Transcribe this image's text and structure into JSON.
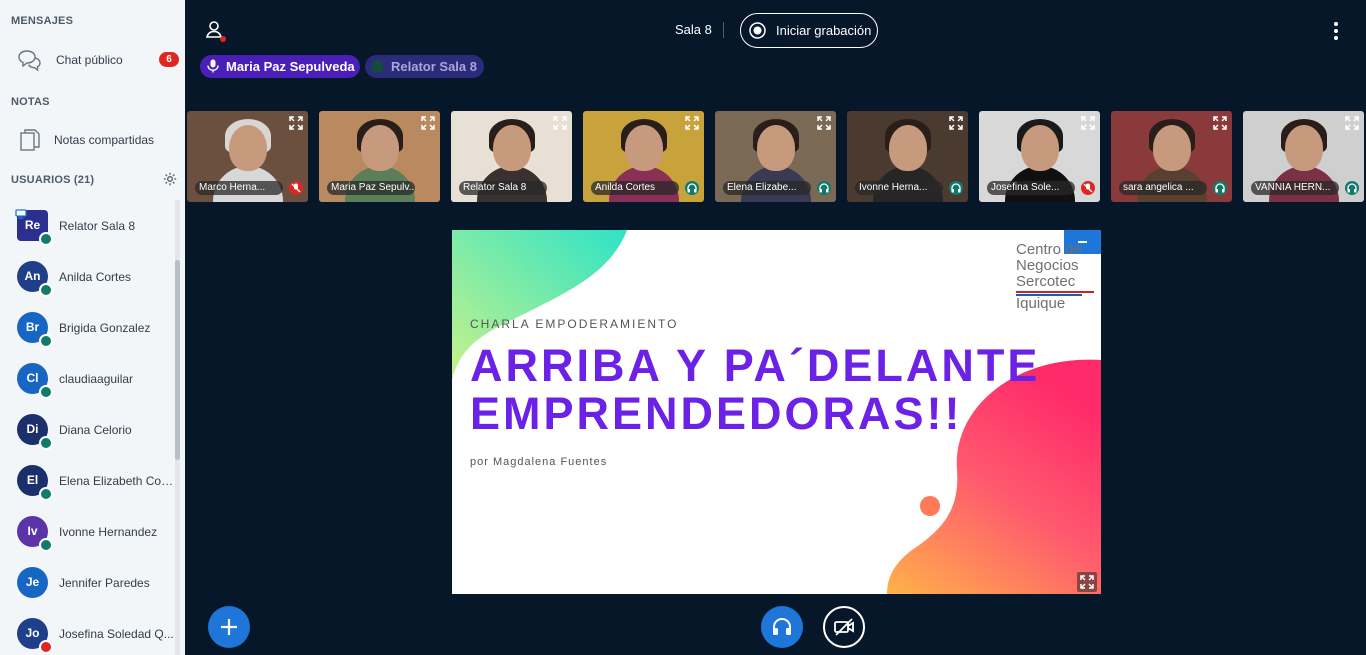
{
  "sidebar": {
    "messages_title": "MENSAJES",
    "public_chat": {
      "label": "Chat público",
      "badge": "6",
      "icon": "chat-icon"
    },
    "notes_title": "NOTAS",
    "shared_notes": {
      "label": "Notas compartidas",
      "icon": "document-icon"
    },
    "users_title": "USUARIOS (21)",
    "users": [
      {
        "initials": "Re",
        "name": "Relator Sala 8",
        "color": "#2b2f90",
        "status": "mic",
        "presenter": true
      },
      {
        "initials": "An",
        "name": "Anilda Cortes",
        "color": "#1f3f8a",
        "status": "listen"
      },
      {
        "initials": "Br",
        "name": "Brigida Gonzalez",
        "color": "#1866c4",
        "status": "listen"
      },
      {
        "initials": "Cl",
        "name": "claudiaaguilar",
        "color": "#1866c4",
        "status": "listen"
      },
      {
        "initials": "Di",
        "name": "Diana Celorio",
        "color": "#1a2f6b",
        "status": "listen"
      },
      {
        "initials": "El",
        "name": "Elena Elizabeth Con...",
        "color": "#1a2f6b",
        "status": "listen"
      },
      {
        "initials": "Iv",
        "name": "Ivonne Hernandez",
        "color": "#5b35a8",
        "status": "listen"
      },
      {
        "initials": "Je",
        "name": "Jennifer Paredes",
        "color": "#1866c4",
        "status": "none"
      },
      {
        "initials": "Jo",
        "name": "Josefina Soledad Q...",
        "color": "#1f3f8a",
        "status": "muted"
      }
    ]
  },
  "topbar": {
    "room": "Sala 8",
    "record_label": "Iniciar grabación"
  },
  "talking": [
    {
      "name": "Maria Paz Sepulveda",
      "active": true
    },
    {
      "name": "Relator Sala 8",
      "active": false
    }
  ],
  "tiles": [
    {
      "name": "Marco Herna...",
      "status": "muted",
      "bg": "#6b5040",
      "shirt": "#d8d8d8",
      "hair": "#d9d6d2"
    },
    {
      "name": "Maria Paz Sepulv...",
      "status": "none",
      "bg": "#b98a60",
      "shirt": "#5c7f5a",
      "hair": "#2a1e1a"
    },
    {
      "name": "Relator Sala 8",
      "status": "none",
      "bg": "#e8dfd5",
      "shirt": "#3a3030",
      "hair": "#2a1e1a"
    },
    {
      "name": "Anilda Cortes",
      "status": "listen",
      "bg": "#c8a23a",
      "shirt": "#8a2f55",
      "hair": "#2a1e1a"
    },
    {
      "name": "Elena Elizabe...",
      "status": "listen",
      "bg": "#7a6a55",
      "shirt": "#3a3a55",
      "hair": "#2a1e1a"
    },
    {
      "name": "Ivonne Herna...",
      "status": "listen",
      "bg": "#4b3a30",
      "shirt": "#262626",
      "hair": "#2a1e1a"
    },
    {
      "name": "Josefina Sole...",
      "status": "muted",
      "bg": "#d8d8d8",
      "shirt": "#101010",
      "hair": "#1a1a1a"
    },
    {
      "name": "sara angelica ...",
      "status": "listen",
      "bg": "#8a3a3a",
      "shirt": "#5a4030",
      "hair": "#2a1e1a"
    },
    {
      "name": "VANNIA HERN...",
      "status": "listen",
      "bg": "#cfcfcf",
      "shirt": "#7a3045",
      "hair": "#2a1e1a"
    }
  ],
  "slide": {
    "kicker": "CHARLA EMPODERAMIENTO",
    "title_line1": "ARRIBA Y PA´DELANTE",
    "title_line2": "EMPRENDEDORAS!!",
    "byline": "por Magdalena Fuentes",
    "logo": [
      "Centro de",
      "Negocios",
      "Sercotec",
      "Iquique"
    ]
  },
  "colors": {
    "accent": "#1d76d8",
    "title": "#6b22e6",
    "muted": "#df2721",
    "listen": "#0f7b6c"
  }
}
